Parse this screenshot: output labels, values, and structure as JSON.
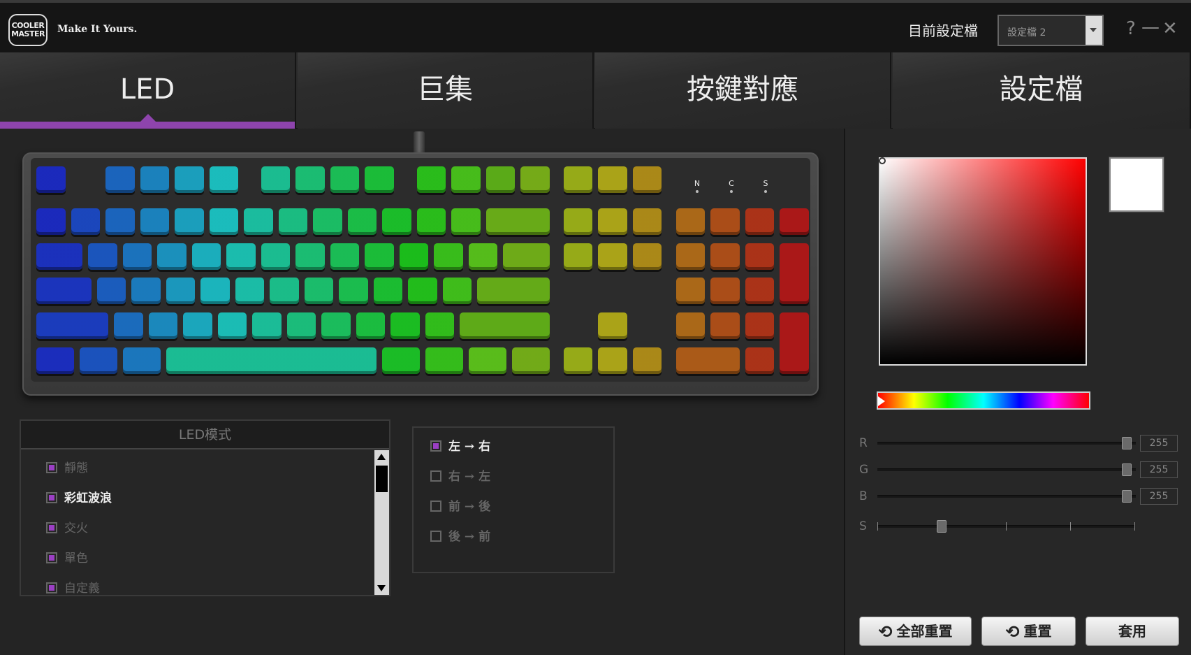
{
  "header": {
    "logo_text": "COOLER MASTER",
    "tagline": "Make It Yours.",
    "profile_label": "目前設定檔",
    "profile_value": "設定檔 2",
    "help": "?",
    "minimize": "—",
    "close": "✕"
  },
  "tabs": [
    {
      "label": "LED",
      "active": true
    },
    {
      "label": "巨集",
      "active": false
    },
    {
      "label": "按鍵對應",
      "active": false
    },
    {
      "label": "設定檔",
      "active": false
    }
  ],
  "keyboard": {
    "indicators": [
      "N",
      "C",
      "S"
    ],
    "layout": "full-size",
    "effect": "rainbow-wave-left-to-right"
  },
  "led_mode": {
    "header": "LED模式",
    "items": [
      {
        "label": "靜態",
        "selected": false
      },
      {
        "label": "彩虹波浪",
        "selected": true
      },
      {
        "label": "交火",
        "selected": false
      },
      {
        "label": "單色",
        "selected": false
      },
      {
        "label": "自定義",
        "selected": false
      }
    ]
  },
  "direction": {
    "items": [
      {
        "label": "左 → 右",
        "checked": true
      },
      {
        "label": "右 → 左",
        "checked": false
      },
      {
        "label": "前 → 後",
        "checked": false
      },
      {
        "label": "後 → 前",
        "checked": false
      }
    ]
  },
  "color": {
    "selected_hex": "#FFFFFF",
    "hue": "#FF0000",
    "sliders": [
      {
        "label": "R",
        "value": "255",
        "fraction": 1.0
      },
      {
        "label": "G",
        "value": "255",
        "fraction": 1.0
      },
      {
        "label": "B",
        "value": "255",
        "fraction": 1.0
      }
    ],
    "speed": {
      "label": "S",
      "level_fraction": 0.25
    }
  },
  "buttons": {
    "reset_all": "全部重置",
    "reset": "重置",
    "apply": "套用"
  },
  "accent": "#8E44AD"
}
